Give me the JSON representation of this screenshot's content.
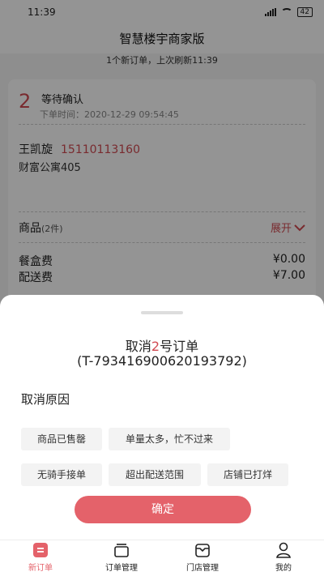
{
  "status_bar": {
    "time": "11:39",
    "battery": "42"
  },
  "header": {
    "title": "智慧楼宇商家版"
  },
  "refresh": {
    "text": "1个新订单，上次刷新11:39"
  },
  "order": {
    "number": "2",
    "status": "等待确认",
    "time": "下单时间：2020-12-29 09:54:45",
    "customer_name": "王凯旋",
    "customer_phone": "15110113160",
    "address": "财富公寓405",
    "goods_label": "商品",
    "goods_count": "(2件)",
    "expand_label": "展开",
    "fees": [
      {
        "label": "餐盒费",
        "value": "¥0.00"
      },
      {
        "label": "配送费",
        "value": "¥7.00"
      }
    ]
  },
  "cancel_sheet": {
    "title_prefix": "取消",
    "title_number": "2",
    "title_suffix": "号订单",
    "order_id": "(T-793416900620193792)",
    "reason_title": "取消原因",
    "reasons": [
      "商品已售罄",
      "单量太多，忙不过来",
      "无骑手接单",
      "超出配送范围",
      "店铺已打烊"
    ],
    "confirm_label": "确定"
  },
  "tabbar": {
    "items": [
      {
        "label": "新订单",
        "icon": "new-order-icon",
        "active": true
      },
      {
        "label": "订单管理",
        "icon": "order-manage-icon",
        "active": false
      },
      {
        "label": "门店管理",
        "icon": "store-manage-icon",
        "active": false
      },
      {
        "label": "我的",
        "icon": "profile-icon",
        "active": false
      }
    ]
  },
  "colors": {
    "accent": "#e4626a",
    "highlight": "#d14a52"
  }
}
